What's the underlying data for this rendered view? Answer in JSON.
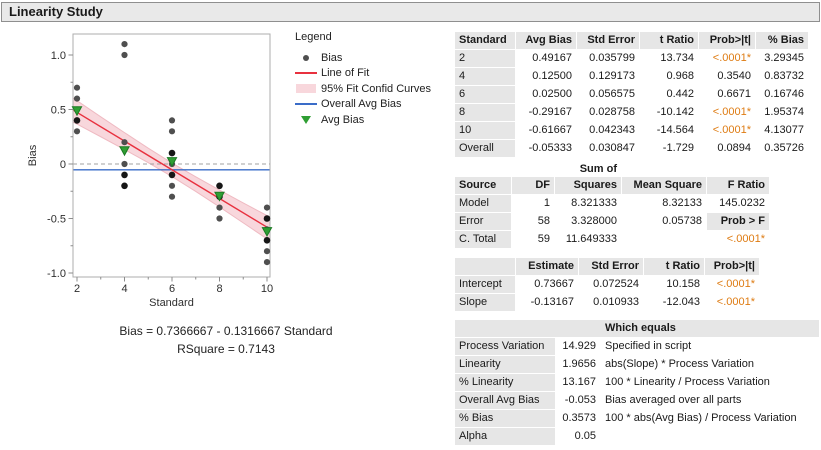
{
  "title": "Linearity Study",
  "legend": {
    "title": "Legend",
    "items": [
      {
        "label": "Bias",
        "icon": "dot-marker-icon"
      },
      {
        "label": "Line of Fit",
        "icon": "fit-line-icon"
      },
      {
        "label": "95% Fit Confid Curves",
        "icon": "confid-band-swatch-icon"
      },
      {
        "label": "Overall Avg Bias",
        "icon": "overall-avg-bias-line-icon"
      },
      {
        "label": "Avg Bias",
        "icon": "avg-bias-triangle-icon"
      }
    ]
  },
  "equation": {
    "line1": "Bias = 0.7366667 - 0.1316667 Standard",
    "line2": "RSquare = 0.7143"
  },
  "chart_data": {
    "type": "scatter",
    "xlabel": "Standard",
    "ylabel": "Bias",
    "xlim": [
      1.83,
      10.13
    ],
    "ylim": [
      -1.04,
      1.2
    ],
    "xticks": [
      2,
      4,
      6,
      8,
      10
    ],
    "xticks_minor": [
      3,
      5,
      7,
      9
    ],
    "yticks": [
      -1,
      -0.5,
      0,
      0.5,
      1
    ],
    "ytick_labels": [
      "-1.0",
      "-0.5",
      "0",
      "0.5",
      "1.0"
    ],
    "yticks_minor": [
      -0.75,
      -0.25,
      0.25,
      0.75
    ],
    "zero_reference_line": 0,
    "series": [
      {
        "name": "Bias",
        "type": "points",
        "points": [
          [
            2,
            0.7
          ],
          [
            2,
            0.6
          ],
          [
            2,
            0.5
          ],
          [
            2,
            0.3
          ],
          [
            4,
            1.1
          ],
          [
            4,
            1.0
          ],
          [
            4,
            0.2
          ],
          [
            4,
            0.0
          ],
          [
            6,
            0.4
          ],
          [
            6,
            0.3
          ],
          [
            6,
            0.0
          ],
          [
            6,
            -0.2
          ],
          [
            6,
            -0.3
          ],
          [
            8,
            -0.4
          ],
          [
            8,
            -0.5
          ],
          [
            10,
            -0.4
          ],
          [
            10,
            -0.6
          ],
          [
            10,
            -0.8
          ],
          [
            10,
            -0.9
          ]
        ],
        "points_overlap": [
          [
            2,
            0.4
          ],
          [
            4,
            -0.1
          ],
          [
            4,
            -0.2
          ],
          [
            6,
            0.1
          ],
          [
            6,
            -0.1
          ],
          [
            8,
            -0.2
          ],
          [
            8,
            -0.3
          ],
          [
            10,
            -0.5
          ],
          [
            10,
            -0.7
          ]
        ]
      },
      {
        "name": "Line of Fit",
        "type": "line",
        "intercept": 0.7366667,
        "slope": -0.1316667
      },
      {
        "name": "95% Fit Confid Curves",
        "type": "band",
        "x": [
          1.83,
          2,
          3,
          4,
          5,
          6,
          7,
          8,
          9,
          10,
          10.13
        ],
        "upper": [
          0.606,
          0.581,
          0.433,
          0.288,
          0.145,
          0.009,
          -0.118,
          -0.239,
          -0.357,
          -0.473,
          -0.486
        ],
        "lower": [
          0.385,
          0.366,
          0.25,
          0.132,
          0.012,
          -0.115,
          -0.252,
          -0.394,
          -0.54,
          -0.687,
          -0.707
        ]
      },
      {
        "name": "Overall Avg Bias",
        "type": "hline",
        "y": -0.05333
      },
      {
        "name": "Avg Bias",
        "type": "triangles",
        "points": [
          [
            2,
            0.49167
          ],
          [
            4,
            0.125
          ],
          [
            6,
            0.025
          ],
          [
            8,
            -0.29167
          ],
          [
            10,
            -0.61667
          ]
        ]
      }
    ]
  },
  "tables": {
    "avg_bias": {
      "columns": [
        "Standard",
        "Avg Bias",
        "Std Error",
        "t Ratio",
        "Prob>|t|",
        "% Bias"
      ],
      "rows": [
        {
          "label": "2",
          "cells": [
            "0.49167",
            "0.035799",
            "13.734",
            {
              "t": "<.0001*",
              "sig": true
            },
            "3.29345"
          ]
        },
        {
          "label": "4",
          "cells": [
            "0.12500",
            "0.129173",
            "0.968",
            "0.3540",
            "0.83732"
          ]
        },
        {
          "label": "6",
          "cells": [
            "0.02500",
            "0.056575",
            "0.442",
            "0.6671",
            "0.16746"
          ]
        },
        {
          "label": "8",
          "cells": [
            "-0.29167",
            "0.028758",
            "-10.142",
            {
              "t": "<.0001*",
              "sig": true
            },
            "1.95374"
          ]
        },
        {
          "label": "10",
          "cells": [
            "-0.61667",
            "0.042343",
            "-14.564",
            {
              "t": "<.0001*",
              "sig": true
            },
            "4.13077"
          ]
        },
        {
          "label": "Overall",
          "cells": [
            "-0.05333",
            "0.030847",
            "-1.729",
            "0.0894",
            "0.35726"
          ]
        }
      ]
    },
    "anova": {
      "columns": [
        "Source",
        "DF",
        "Squares",
        "Mean Square",
        "F Ratio"
      ],
      "over_header": {
        "col": 2,
        "text": "Sum of"
      },
      "rows": [
        {
          "label": "Model",
          "cells": [
            "1",
            "8.321333",
            "8.32133",
            "145.0232"
          ]
        },
        {
          "label": "Error",
          "cells": [
            "58",
            "3.328000",
            "0.05738",
            {
              "t": "Prob > F",
              "hdr": true
            }
          ]
        },
        {
          "label": "C. Total",
          "cells": [
            "59",
            "11.649333",
            "",
            {
              "t": "<.0001*",
              "sig": true
            }
          ]
        }
      ]
    },
    "estimates": {
      "columns": [
        "",
        "Estimate",
        "Std Error",
        "t Ratio",
        "Prob>|t|"
      ],
      "rows": [
        {
          "label": "Intercept",
          "cells": [
            "0.73667",
            "0.072524",
            "10.158",
            {
              "t": "<.0001*",
              "sig": true
            }
          ]
        },
        {
          "label": "Slope",
          "cells": [
            "-0.13167",
            "0.010933",
            "-12.043",
            {
              "t": "<.0001*",
              "sig": true
            }
          ]
        }
      ]
    },
    "which_equals": {
      "header": "Which equals",
      "rows": [
        {
          "label": "Process Variation",
          "value": "14.929",
          "formula": "Specified in script"
        },
        {
          "label": "Linearity",
          "value": "1.9656",
          "formula": "abs(Slope) * Process Variation"
        },
        {
          "label": "% Linearity",
          "value": "13.167",
          "formula": "100 * Linearity / Process Variation"
        },
        {
          "label": "Overall Avg Bias",
          "value": "-0.053",
          "formula": "Bias averaged over all parts"
        },
        {
          "label": "% Bias",
          "value": "0.3573",
          "formula": "100 * abs(Avg Bias) / Process Variation"
        },
        {
          "label": "Alpha",
          "value": "0.05",
          "formula": ""
        }
      ]
    }
  },
  "colors": {
    "significant": "#de7b12",
    "fit_line": "#e8313f",
    "confid_band": "#f8d7dc",
    "confid_band_edge": "#efbac2",
    "overall_line": "#3a6cc8",
    "bias_dot": "#4f4f4f",
    "bias_dot_overlap": "#161616",
    "avg_marker": "#2f9e33",
    "avg_marker_edge": "#1c7a24",
    "header_bg": "#e6e6e6"
  }
}
